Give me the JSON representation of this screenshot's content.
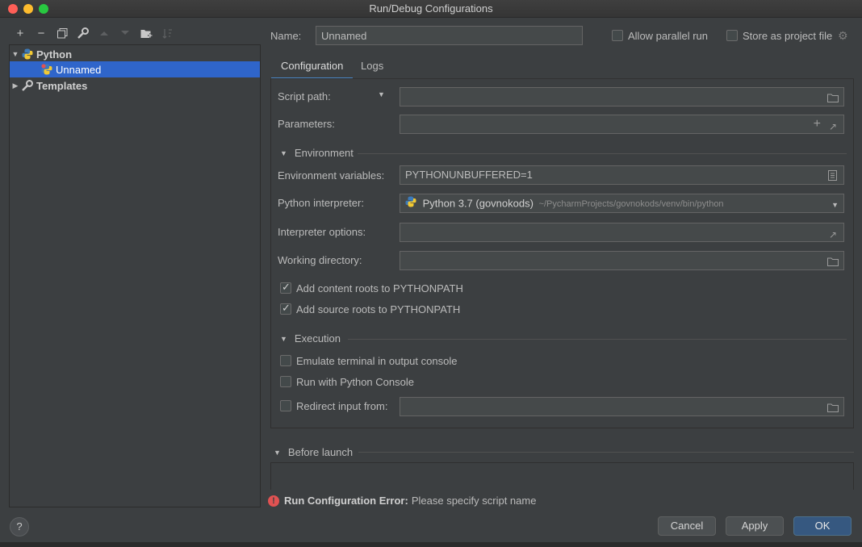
{
  "window": {
    "title": "Run/Debug Configurations"
  },
  "toolbar": {
    "add_glyph": "+",
    "remove_glyph": "−",
    "icons": [
      "plus-icon",
      "minus-icon",
      "copy-icon",
      "wrench-icon",
      "arrow-up-icon",
      "arrow-down-icon",
      "folder-add-icon",
      "sort-icon"
    ]
  },
  "tree": {
    "python": "Python",
    "unnamed": "Unnamed",
    "templates": "Templates"
  },
  "header": {
    "name_label": "Name:",
    "name_value": "Unnamed",
    "allow_parallel": "Allow parallel run",
    "store_project": "Store as project file"
  },
  "tabs": {
    "configuration": "Configuration",
    "logs": "Logs"
  },
  "form": {
    "script_path": "Script path:",
    "parameters": "Parameters:",
    "environment": "Environment",
    "env_vars_label": "Environment variables:",
    "env_vars_value": "PYTHONUNBUFFERED=1",
    "interpreter_label": "Python interpreter:",
    "interpreter_name": "Python 3.7 (govnokods)",
    "interpreter_path": "~/PycharmProjects/govnokods/venv/bin/python",
    "interp_options": "Interpreter options:",
    "working_dir": "Working directory:",
    "add_content_roots": "Add content roots to PYTHONPATH",
    "add_source_roots": "Add source roots to PYTHONPATH",
    "execution": "Execution",
    "emulate_terminal": "Emulate terminal in output console",
    "run_console": "Run with Python Console",
    "redirect_input": "Redirect input from:"
  },
  "before_launch": {
    "title": "Before launch"
  },
  "error": {
    "title": "Run Configuration Error:",
    "message": "Please specify script name"
  },
  "buttons": {
    "help": "?",
    "cancel": "Cancel",
    "apply": "Apply",
    "ok": "OK"
  },
  "colors": {
    "selection": "#2f65ca",
    "accent_tab": "#4a88c7",
    "error": "#e05252",
    "primary_button": "#365880"
  }
}
